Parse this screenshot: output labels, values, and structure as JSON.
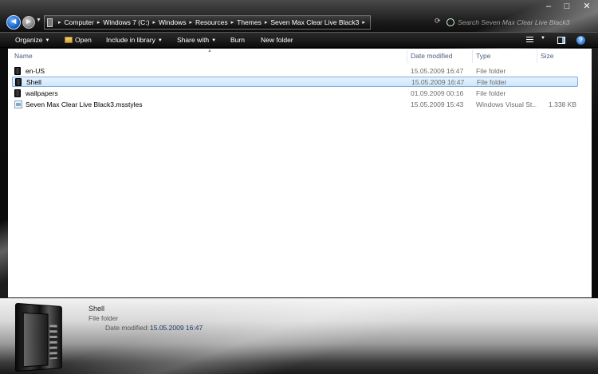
{
  "window": {
    "minimize_label": "–",
    "maximize_label": "□",
    "close_label": "✕"
  },
  "navigation": {
    "back_label": "◄",
    "forward_label": "►",
    "breadcrumb": [
      "Computer",
      "Windows 7 (C:)",
      "Windows",
      "Resources",
      "Themes",
      "Seven Max Clear Live Black3"
    ],
    "separator": "▸",
    "search_placeholder": "Search Seven Max Clear Live Black3"
  },
  "toolbar": {
    "organize": "Organize",
    "open": "Open",
    "include": "Include in library",
    "share": "Share with",
    "burn": "Burn",
    "new_folder": "New folder",
    "help": "?"
  },
  "columns": {
    "name": "Name",
    "date": "Date modified",
    "type": "Type",
    "size": "Size"
  },
  "files": [
    {
      "name": "en-US",
      "date": "15.05.2009 16:47",
      "type": "File folder",
      "size": "",
      "kind": "folder"
    },
    {
      "name": "Shell",
      "date": "15.05.2009 16:47",
      "type": "File folder",
      "size": "",
      "kind": "folder",
      "selected": true
    },
    {
      "name": "wallpapers",
      "date": "01.09.2009 00:16",
      "type": "File folder",
      "size": "",
      "kind": "folder"
    },
    {
      "name": "Seven Max Clear Live Black3.msstyles",
      "date": "15.05.2009 15:43",
      "type": "Windows Visual St...",
      "size": "1.338 KB",
      "kind": "file"
    }
  ],
  "details": {
    "name": "Shell",
    "type": "File folder",
    "date_label": "Date modified:",
    "date_value": "15.05.2009 16:47"
  }
}
